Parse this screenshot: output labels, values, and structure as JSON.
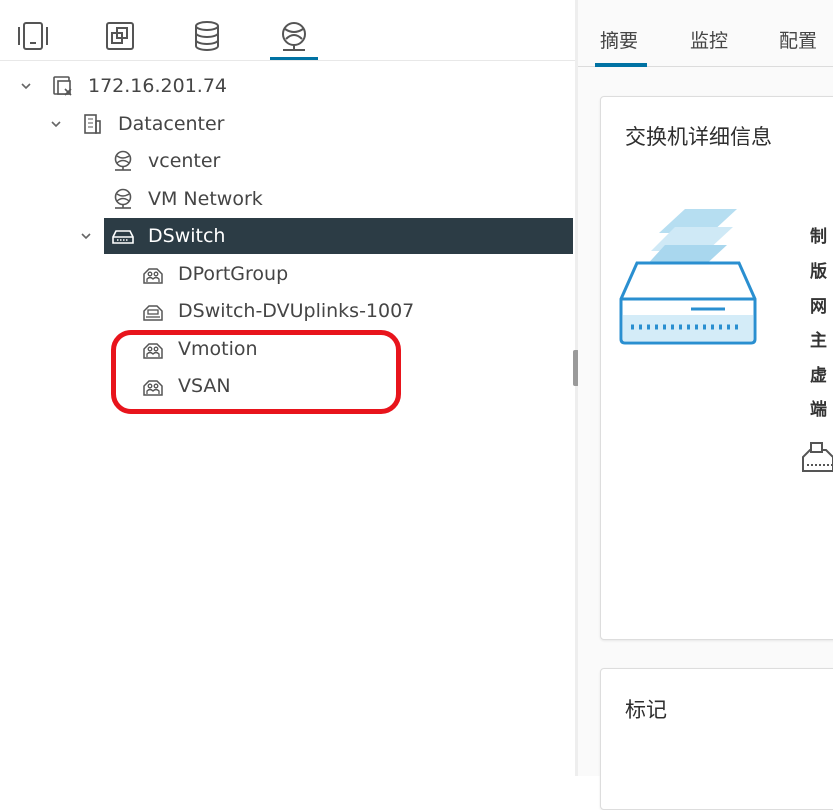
{
  "navigator": {
    "tabs": [
      {
        "name": "hosts-clusters-icon"
      },
      {
        "name": "vms-templates-icon"
      },
      {
        "name": "storage-icon"
      },
      {
        "name": "networking-icon"
      }
    ],
    "tree": [
      {
        "label": "172.16.201.74",
        "icon": "vcenter-icon",
        "expanded": true
      },
      {
        "label": "Datacenter",
        "icon": "datacenter-icon",
        "expanded": true
      },
      {
        "label": "vcenter",
        "icon": "network-icon"
      },
      {
        "label": "VM Network",
        "icon": "network-icon"
      },
      {
        "label": "DSwitch",
        "icon": "distributed-switch-icon",
        "expanded": true,
        "selected": true
      },
      {
        "label": "DPortGroup",
        "icon": "port-group-icon"
      },
      {
        "label": "DSwitch-DVUplinks-1007",
        "icon": "uplink-port-group-icon"
      },
      {
        "label": "Vmotion",
        "icon": "port-group-icon"
      },
      {
        "label": "VSAN",
        "icon": "port-group-icon"
      }
    ]
  },
  "content": {
    "tabs": [
      "摘要",
      "监控",
      "配置"
    ],
    "active_tab": "摘要",
    "switch_details": {
      "title": "交换机详细信息",
      "labels": [
        "制",
        "版",
        "网",
        "主",
        "虚",
        "端"
      ]
    },
    "tags": {
      "title": "标记"
    }
  },
  "colors": {
    "accent": "#0072a3",
    "selected_row": "#2c3c45",
    "annotation": "#e8141c"
  }
}
